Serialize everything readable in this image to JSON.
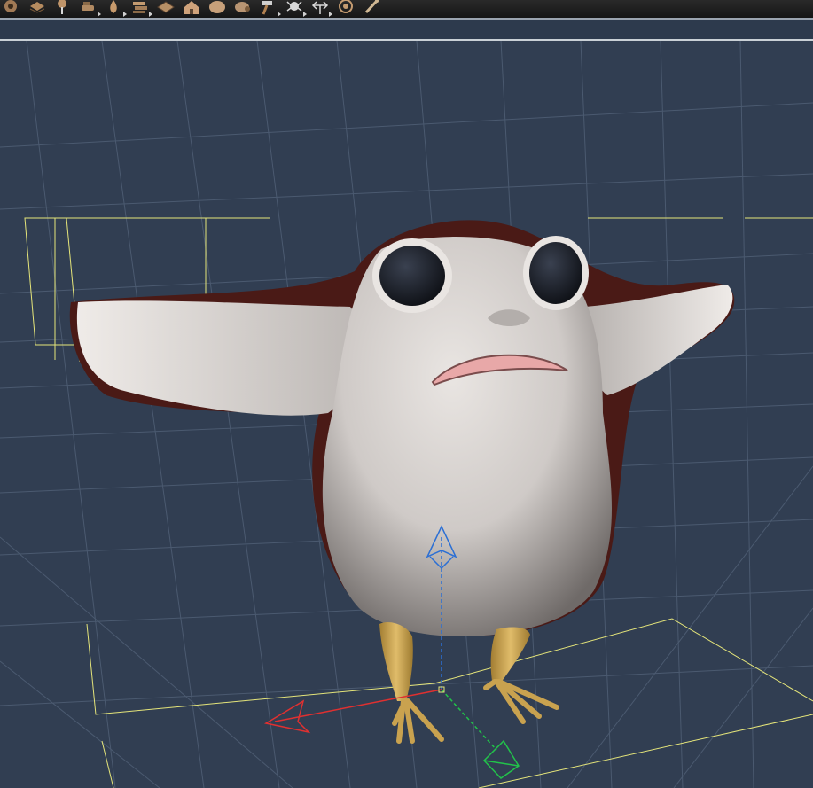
{
  "toolbar": {
    "tools": [
      {
        "name": "universal-tool",
        "icon": "gear-icon",
        "has_menu": false
      },
      {
        "name": "node-weight-map-tool",
        "icon": "layers-icon",
        "has_menu": false
      },
      {
        "name": "pose-tool",
        "icon": "pin-icon",
        "has_menu": false
      },
      {
        "name": "surface-selection-tool",
        "icon": "brush-icon",
        "has_menu": true
      },
      {
        "name": "geometry-editor-tool",
        "icon": "drop-icon",
        "has_menu": true
      },
      {
        "name": "geometry-sculptor-tool",
        "icon": "stack-icon",
        "has_menu": true
      },
      {
        "name": "scene-navigator-tool",
        "icon": "grid-plane-icon",
        "has_menu": false
      },
      {
        "name": "environment-tool",
        "icon": "house-icon",
        "has_menu": false
      },
      {
        "name": "shape-tool",
        "icon": "blob-icon",
        "has_menu": false
      },
      {
        "name": "joint-editor-tool",
        "icon": "joint-icon",
        "has_menu": false
      },
      {
        "name": "transform-tool",
        "icon": "hammer-icon",
        "has_menu": true
      },
      {
        "name": "spot-render-tool",
        "icon": "spider-icon",
        "has_menu": true
      },
      {
        "name": "align-tool",
        "icon": "arrows-icon",
        "has_menu": true
      },
      {
        "name": "target-tool",
        "icon": "target-icon",
        "has_menu": false
      },
      {
        "name": "bone-tool",
        "icon": "bone-icon",
        "has_menu": false
      }
    ]
  },
  "viewport": {
    "label": "3D viewport",
    "background": "#313e52",
    "grid_color": "#4b5a70",
    "bbox_color": "#e5e57a",
    "figure": {
      "body_color": "#cfcac7",
      "back_color": "#4a1a16",
      "eye_color": "#1f232c",
      "leg_color": "#c9a24f",
      "mouth_color": "#e8a8a8"
    },
    "gizmo": {
      "x_color": "#e03030",
      "y_color": "#2b6fd4",
      "z_color": "#22c24a"
    }
  }
}
